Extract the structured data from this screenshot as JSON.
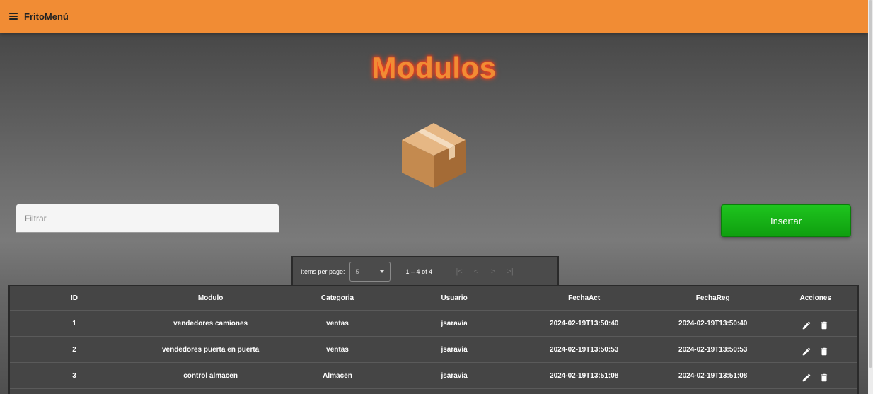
{
  "app": {
    "title": "FritoMenú"
  },
  "page": {
    "title": "Modulos"
  },
  "filter": {
    "placeholder": "Filtrar",
    "value": ""
  },
  "insert_button": {
    "label": "Insertar"
  },
  "paginator": {
    "items_per_page_label": "Items per page:",
    "page_size": "5",
    "range_label": "1 – 4 of 4",
    "nav": [
      "|<",
      "<",
      ">",
      ">|"
    ]
  },
  "table": {
    "headers": {
      "id": "ID",
      "modulo": "Modulo",
      "categoria": "Categoria",
      "usuario": "Usuario",
      "fechaact": "FechaAct",
      "fechareg": "FechaReg",
      "acciones": "Acciones"
    },
    "rows": [
      {
        "id": "1",
        "modulo": "vendedores camiones",
        "categoria": "ventas",
        "usuario": "jsaravia",
        "fechaact": "2024-02-19T13:50:40",
        "fechareg": "2024-02-19T13:50:40"
      },
      {
        "id": "2",
        "modulo": "vendedores puerta en puerta",
        "categoria": "ventas",
        "usuario": "jsaravia",
        "fechaact": "2024-02-19T13:50:53",
        "fechareg": "2024-02-19T13:50:53"
      },
      {
        "id": "3",
        "modulo": "control almacen",
        "categoria": "Almacen",
        "usuario": "jsaravia",
        "fechaact": "2024-02-19T13:51:08",
        "fechareg": "2024-02-19T13:51:08"
      }
    ]
  },
  "icons": {
    "menu": "menu-icon",
    "box": "box-icon",
    "edit": "pencil-icon",
    "delete": "trash-icon"
  },
  "colors": {
    "topbar": "#f18c34",
    "title": "#f18c34",
    "insert_button": "#14b014",
    "table_bg": "#454545"
  }
}
